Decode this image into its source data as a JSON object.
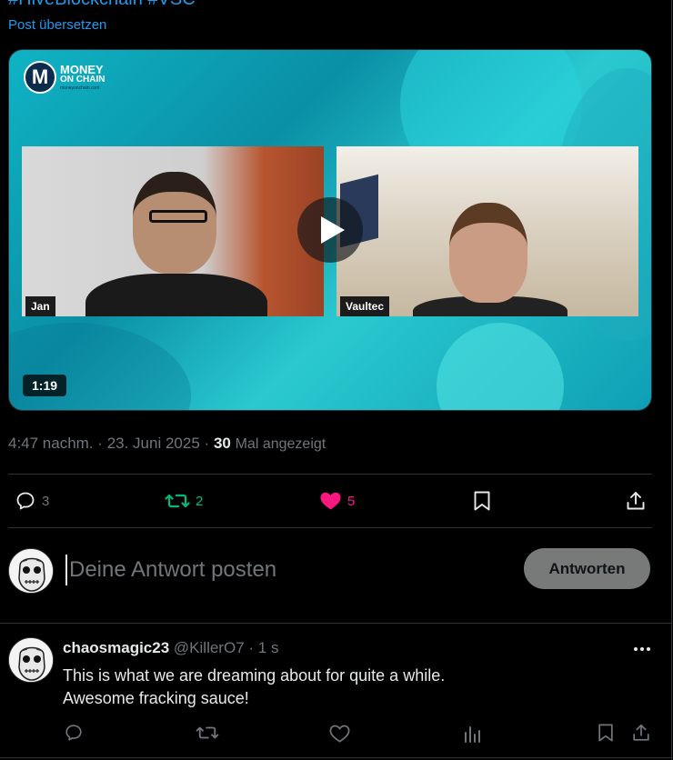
{
  "post": {
    "hashtags": "#HiveBlockchain #VSC",
    "translate": "Post übersetzen",
    "video": {
      "brand_line1": "MONEY",
      "brand_line2": "ON CHAIN",
      "brand_url": "moneyonchain.com",
      "brand_letter": "M",
      "participant_left": "Jan",
      "participant_right": "Vaultec",
      "duration": "1:19"
    },
    "time": "4:47 nachm.",
    "date": "23. Juni 2025",
    "views_count": "30",
    "views_label": "Mal angezeigt",
    "separator": "·",
    "stats": {
      "replies": "3",
      "reposts": "2",
      "likes": "5"
    }
  },
  "reply_box": {
    "placeholder": "Deine Antwort posten",
    "button": "Antworten"
  },
  "comment": {
    "name": "chaosmagic23",
    "handle": "@KillerO7",
    "time": "· 1 s",
    "line1": "This is what we are dreaming about for quite a while.",
    "line2": "Awesome fracking sauce!"
  },
  "colors": {
    "background": "#000000",
    "accent": "#1d9bf0",
    "repost_green": "#00ba7c",
    "like_pink": "#f91880",
    "muted": "#71767b",
    "border": "#2f3336",
    "button_disabled": "#787a7a"
  },
  "icons": {
    "reply": "speech-bubble",
    "repost": "two-arrows-loop",
    "like": "heart-filled",
    "bookmark": "bookmark",
    "share": "upload-arrow",
    "analytics": "bar-chart",
    "more": "three-dots"
  }
}
